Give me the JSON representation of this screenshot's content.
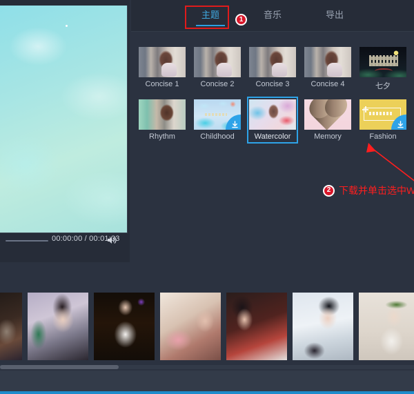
{
  "preview": {
    "time_label": "00:00:00 / 00:01:33",
    "volume_icon": "speaker-icon",
    "progress_percent": 0
  },
  "tabs": [
    {
      "label": "主题",
      "active": true
    },
    {
      "label": "音乐",
      "active": false
    },
    {
      "label": "导出",
      "active": false
    }
  ],
  "annotations": {
    "badge_1": "1",
    "badge_2": "2",
    "step2_text": "下载并单击选中Watercolor主题",
    "color": "#ff1e1e",
    "highlight_border_color": "#e01b1b"
  },
  "themes": [
    {
      "label": "Concise 1",
      "art": "art-girl",
      "download": false,
      "selected": false
    },
    {
      "label": "Concise 2",
      "art": "art-girl",
      "download": false,
      "selected": false
    },
    {
      "label": "Concise 3",
      "art": "art-girl",
      "download": false,
      "selected": false
    },
    {
      "label": "Concise 4",
      "art": "art-girl",
      "download": false,
      "selected": false
    },
    {
      "label": "七夕",
      "art": "art-qixi",
      "download": false,
      "selected": false
    },
    {
      "label": "Rhythm",
      "art": "art-rhythm",
      "download": false,
      "selected": false
    },
    {
      "label": "Childhood",
      "art": "art-childhood",
      "download": true,
      "selected": false
    },
    {
      "label": "Watercolor",
      "art": "art-watercolor",
      "download": false,
      "selected": true
    },
    {
      "label": "Memory",
      "art": "art-memory",
      "download": false,
      "selected": false
    },
    {
      "label": "Fashion",
      "art": "art-fashion",
      "download": true,
      "selected": false
    }
  ],
  "timeline": {
    "clips": [
      {
        "art": "c1",
        "partial": "left"
      },
      {
        "art": "c2",
        "partial": "none"
      },
      {
        "art": "c3",
        "partial": "none"
      },
      {
        "art": "c4",
        "partial": "none"
      },
      {
        "art": "c5",
        "partial": "none"
      },
      {
        "art": "c6",
        "partial": "none"
      },
      {
        "art": "c7",
        "partial": "none"
      },
      {
        "art": "c8",
        "partial": "right"
      }
    ],
    "scroll_percent": 29
  },
  "colors": {
    "panel_bg": "#2b3240",
    "tabbar_bg": "#262c38",
    "accent": "#2ea3e8",
    "selection": "#2ea3e8",
    "badge_red": "#d8172a",
    "bottom_bar": "#1e8ccc"
  }
}
